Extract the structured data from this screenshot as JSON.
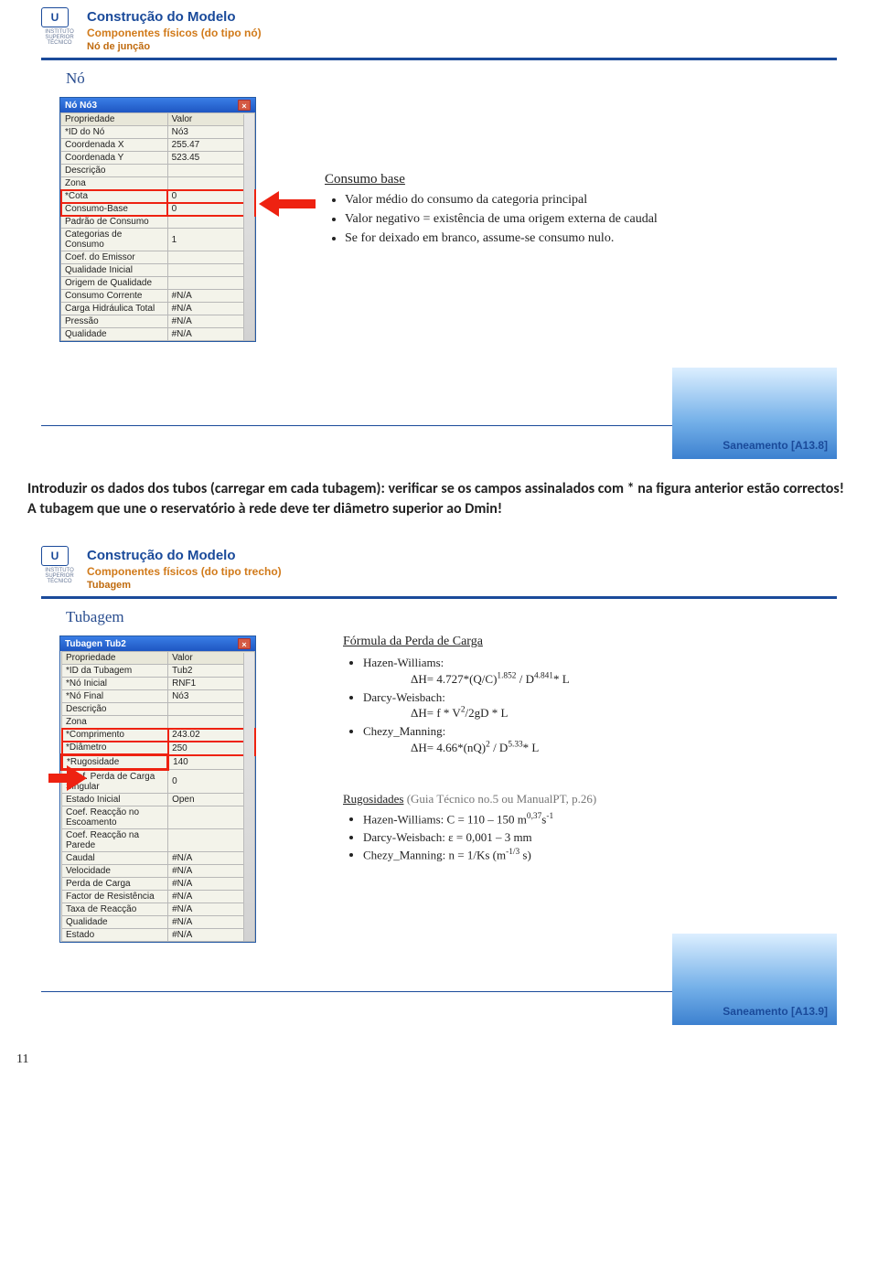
{
  "slide1": {
    "header": {
      "title": "Construção do Modelo",
      "sub1": "Componentes físicos (do tipo nó)",
      "sub2": "Nó de junção"
    },
    "section_label": "Nó",
    "dialog": {
      "title": "Nó Nó3",
      "close": "×",
      "cols": [
        "Propriedade",
        "Valor"
      ],
      "rows": [
        [
          "*ID do Nó",
          "Nó3"
        ],
        [
          "Coordenada X",
          "255.47"
        ],
        [
          "Coordenada Y",
          "523.45"
        ],
        [
          "Descrição",
          ""
        ],
        [
          "Zona",
          ""
        ],
        [
          "*Cota",
          "0"
        ],
        [
          "Consumo-Base",
          "0"
        ],
        [
          "Padrão de Consumo",
          ""
        ],
        [
          "Categorias de Consumo",
          "1"
        ],
        [
          "Coef. do Emissor",
          ""
        ],
        [
          "Qualidade Inicial",
          ""
        ],
        [
          "Origem de Qualidade",
          ""
        ],
        [
          "Consumo Corrente",
          "#N/A"
        ],
        [
          "Carga Hidráulica Total",
          "#N/A"
        ],
        [
          "Pressão",
          "#N/A"
        ],
        [
          "Qualidade",
          "#N/A"
        ]
      ]
    },
    "callout": {
      "title": "Consumo base",
      "items": [
        "Valor médio do consumo da categoria principal",
        "Valor negativo = existência de uma origem externa de caudal",
        "Se for deixado em branco, assume-se consumo nulo."
      ]
    },
    "footer": "Saneamento  [A13.8]"
  },
  "mid_paragraph": "Introduzir os dados dos tubos (carregar em cada tubagem): verificar se os campos assinalados com * na figura anterior estão correctos! A tubagem que une o reservatório à rede deve ter diâmetro superior ao Dmin!",
  "slide2": {
    "header": {
      "title": "Construção do Modelo",
      "sub1": "Componentes físicos (do tipo trecho)",
      "sub2": "Tubagem"
    },
    "section_label": "Tubagem",
    "dialog": {
      "title": "Tubagen Tub2",
      "close": "×",
      "cols": [
        "Propriedade",
        "Valor"
      ],
      "rows": [
        [
          "*ID da Tubagem",
          "Tub2"
        ],
        [
          "*Nó Inicial",
          "RNF1"
        ],
        [
          "*Nó Final",
          "Nó3"
        ],
        [
          "Descrição",
          ""
        ],
        [
          "Zona",
          ""
        ],
        [
          "*Comprimento",
          "243.02"
        ],
        [
          "*Diâmetro",
          "250"
        ],
        [
          "*Rugosidade",
          "140"
        ],
        [
          "Coef. Perda de Carga Singular",
          "0"
        ],
        [
          "Estado Inicial",
          "Open"
        ],
        [
          "Coef. Reacção no Escoamento",
          ""
        ],
        [
          "Coef. Reacção na Parede",
          ""
        ],
        [
          "Caudal",
          "#N/A"
        ],
        [
          "Velocidade",
          "#N/A"
        ],
        [
          "Perda de Carga",
          "#N/A"
        ],
        [
          "Factor de Resistência",
          "#N/A"
        ],
        [
          "Taxa de Reacção",
          "#N/A"
        ],
        [
          "Qualidade",
          "#N/A"
        ],
        [
          "Estado",
          "#N/A"
        ]
      ]
    },
    "callout1": {
      "title": "Fórmula da Perda de Carga",
      "items": [
        "Hazen-Williams:",
        "Darcy-Weisbach:",
        "Chezy_Manning:"
      ],
      "eq_hw_a": "ΔH= 4.727*(Q/C)",
      "eq_hw_b": "1.852",
      "eq_hw_c": " / D",
      "eq_hw_d": "4.841",
      "eq_hw_e": "* L",
      "eq_dw": "ΔH= f * V",
      "eq_dw_sup": "2",
      "eq_dw_tail": "/2gD * L",
      "eq_cm_a": "ΔH= 4.66*(nQ)",
      "eq_cm_b": "2",
      "eq_cm_c": " / D",
      "eq_cm_d": "5.33",
      "eq_cm_e": "* L"
    },
    "callout2": {
      "title": "Rugosidades",
      "title_tail": " (Guia Técnico no.5 ou ManualPT, p.26)",
      "items": [
        "Hazen-Williams: C = 110 – 150  m",
        "Darcy-Weisbach: ε = 0,001 – 3  mm",
        "Chezy_Manning: n = 1/Ks (m"
      ],
      "hw_sup": "0,37",
      "hw_tail": "s",
      "hw_sup2": "-1",
      "cm_sup": "-1/3",
      "cm_tail": " s)"
    },
    "footer": "Saneamento  [A13.9]"
  },
  "page_number": "11"
}
